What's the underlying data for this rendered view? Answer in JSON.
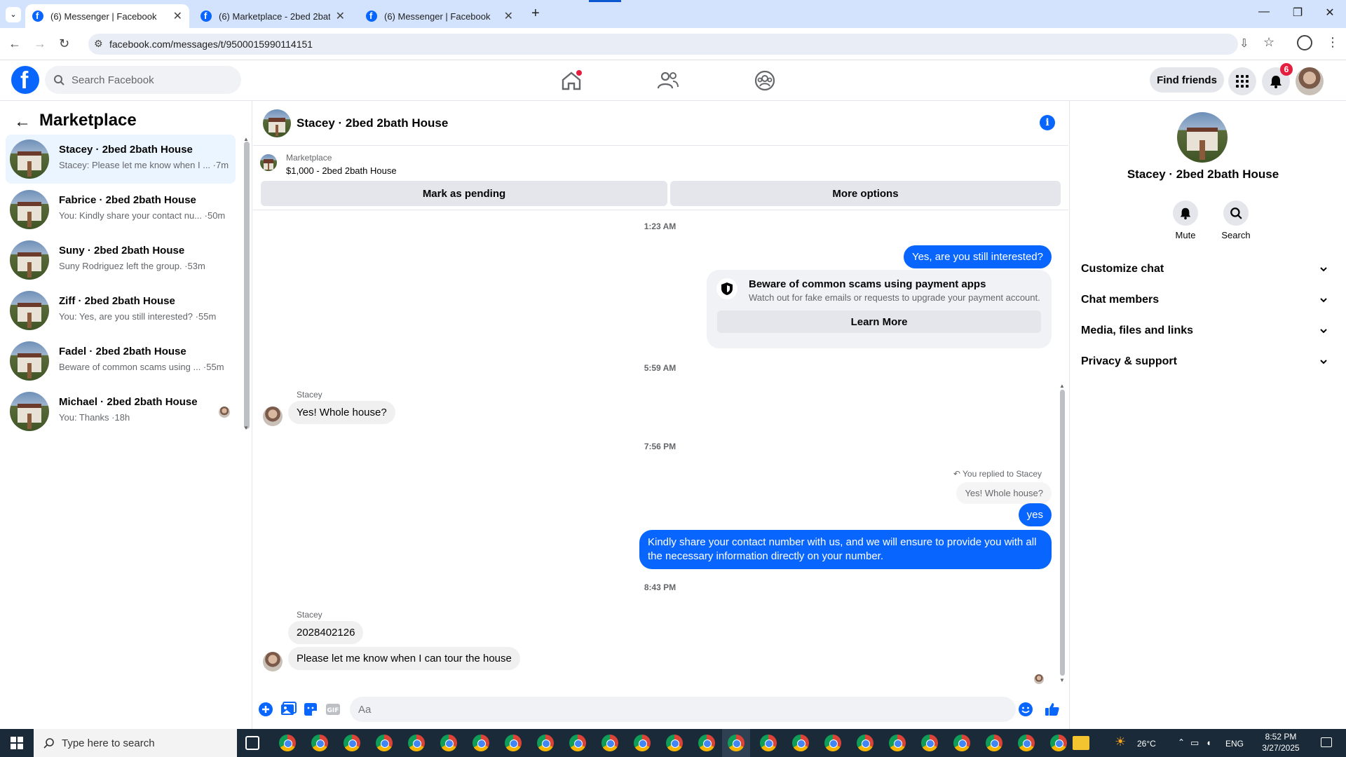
{
  "browser": {
    "tabs": [
      {
        "title": "(6) Messenger | Facebook",
        "active": true
      },
      {
        "title": "(6) Marketplace - 2bed 2bath H",
        "active": false
      },
      {
        "title": "(6) Messenger | Facebook",
        "active": false
      }
    ],
    "url": "facebook.com/messages/t/9500015990114151"
  },
  "fb": {
    "logo": "f",
    "search_placeholder": "Search Facebook",
    "find_friends": "Find friends",
    "notif_count": "6"
  },
  "left": {
    "title": "Marketplace",
    "conversations": [
      {
        "name": "Stacey · 2bed 2bath House",
        "snippet": "Stacey: Please let me know when I ... ·7m",
        "active": true
      },
      {
        "name": "Fabrice · 2bed 2bath House",
        "snippet": "You: Kindly share your contact nu... ·50m",
        "active": false
      },
      {
        "name": "Suny · 2bed 2bath House",
        "snippet": "Suny Rodriguez left the group. ·53m",
        "active": false
      },
      {
        "name": "Ziff · 2bed 2bath House",
        "snippet": "You: Yes, are you still interested? ·55m",
        "active": false
      },
      {
        "name": "Fadel · 2bed 2bath House",
        "snippet": "Beware of common scams using ... ·55m",
        "active": false
      },
      {
        "name": "Michael · 2bed 2bath House",
        "snippet": "You: Thanks ·18h",
        "active": false
      }
    ]
  },
  "chat": {
    "title": "Stacey · 2bed 2bath House",
    "listing_label": "Marketplace",
    "listing_price": "$1,000 - 2bed 2bath House",
    "mark_pending": "Mark as pending",
    "more_options": "More options",
    "t1": "1:23 AM",
    "msg_out_1": "Yes, are you still interested?",
    "scam_title": "Beware of common scams using payment apps",
    "scam_desc": "Watch out for fake emails or requests to upgrade your payment account.",
    "scam_btn": "Learn More",
    "t2": "5:59 AM",
    "sender_1": "Stacey",
    "msg_in_1": "Yes! Whole house?",
    "t3": "7:56 PM",
    "replied_label": "You replied to Stacey",
    "replied_quote": "Yes! Whole house?",
    "msg_out_2": "yes",
    "msg_out_3": "Kindly share your contact number with us, and we will ensure to provide you with all the necessary information directly on your number.",
    "t4": "8:43 PM",
    "sender_2": "Stacey",
    "msg_in_2": "2028402126",
    "msg_in_3": "Please let me know when I can tour the house",
    "composer_placeholder": "Aa"
  },
  "right": {
    "title": "Stacey · 2bed 2bath House",
    "mute": "Mute",
    "search": "Search",
    "sections": [
      "Customize chat",
      "Chat members",
      "Media, files and links",
      "Privacy & support"
    ]
  },
  "taskbar": {
    "search_placeholder": "Type here to search",
    "temp": "26°C",
    "lang": "ENG",
    "time": "8:52 PM",
    "date": "3/27/2025"
  },
  "colors": {
    "accent": "#0866ff",
    "bubble_in": "#f0f0f0"
  }
}
